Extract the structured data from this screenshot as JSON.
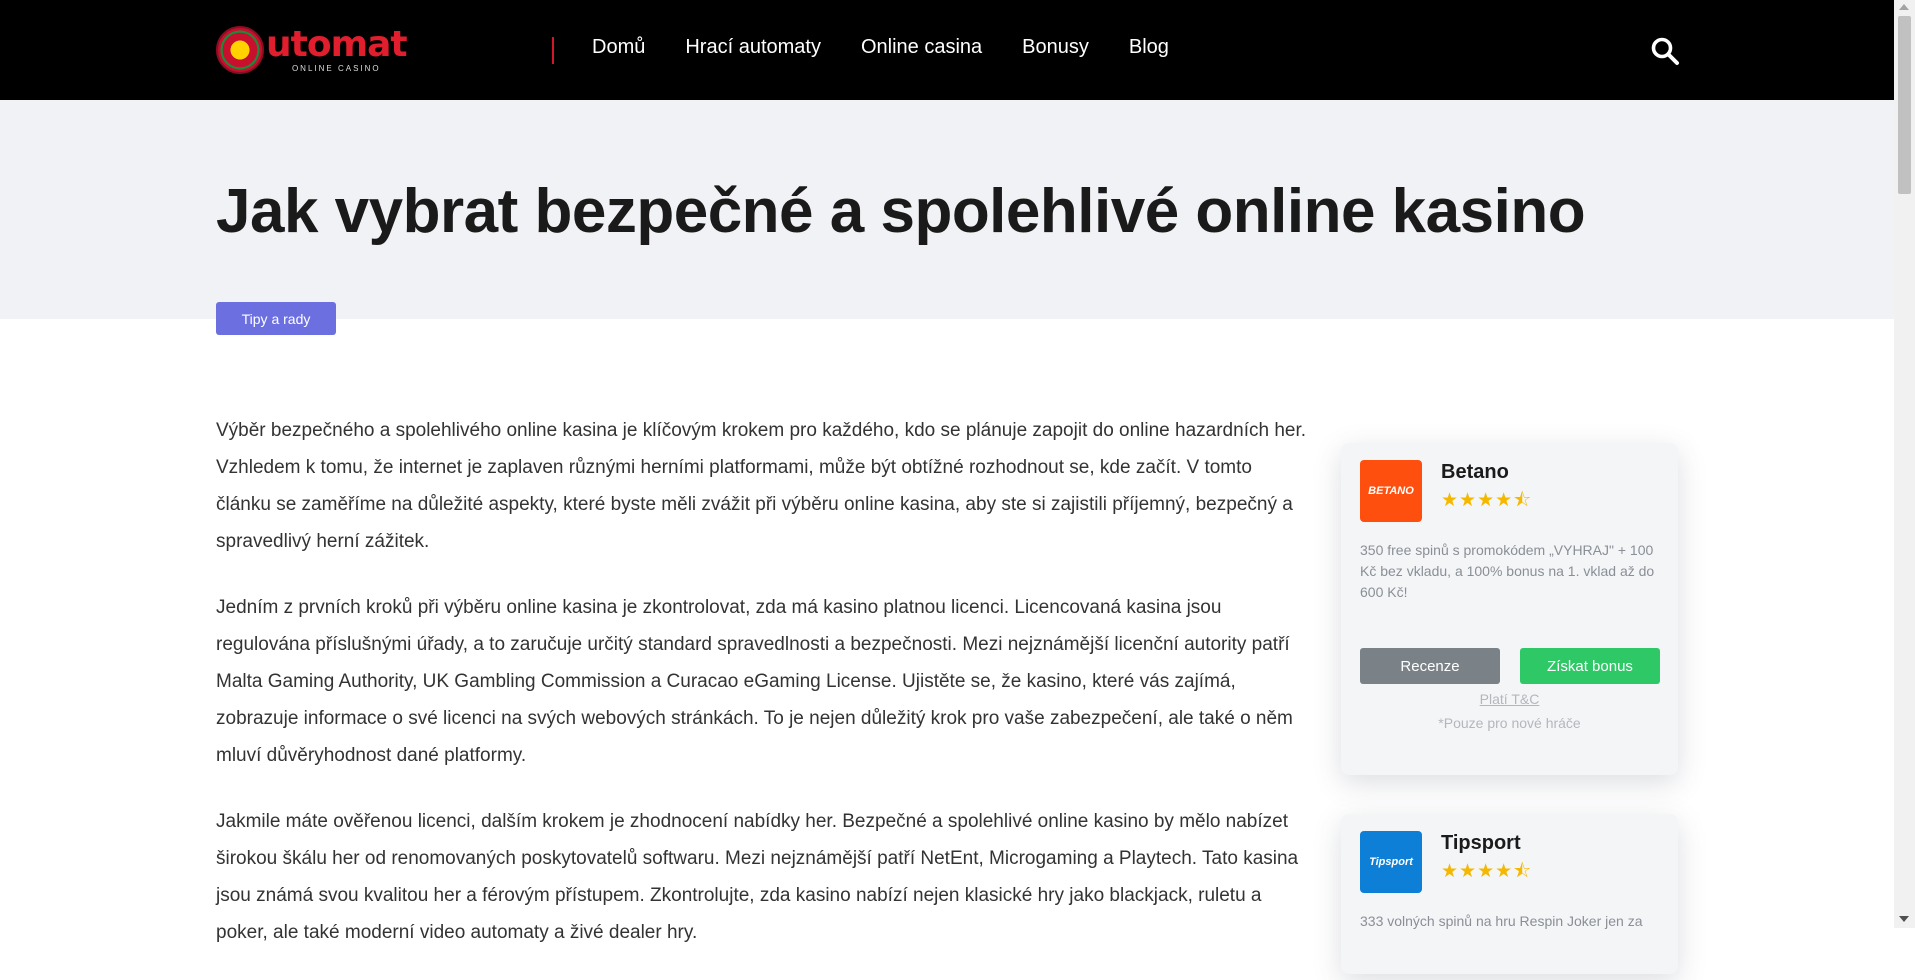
{
  "header": {
    "logo": {
      "text": "utomat",
      "subtitle": "ONLINE CASINO"
    },
    "nav": [
      {
        "label": "Domů"
      },
      {
        "label": "Hrací automaty"
      },
      {
        "label": "Online casina"
      },
      {
        "label": "Bonusy"
      },
      {
        "label": "Blog"
      }
    ],
    "search_icon": "search-icon"
  },
  "page": {
    "title": "Jak vybrat bezpečné a spolehlivé online kasino",
    "tag": "Tipy a rady"
  },
  "article": {
    "paragraphs": [
      "Výběr bezpečného a spolehlivého online kasina je klíčovým krokem pro každého, kdo se plánuje zapojit do online hazardních her. Vzhledem k tomu, že internet je zaplaven různými herními platformami, může být obtížné rozhodnout se, kde začít. V tomto článku se zaměříme na důležité aspekty, které byste měli zvážit při výběru online kasina, aby ste si zajistili příjemný, bezpečný a spravedlivý herní zážitek.",
      "Jedním z prvních kroků při výběru online kasina je zkontrolovat, zda má kasino platnou licenci. Licencovaná kasina jsou regulována příslušnými úřady, a to zaručuje určitý standard spravedlnosti a bezpečnosti. Mezi nejznámější licenční autority patří Malta Gaming Authority, UK Gambling Commission a Curacao eGaming License. Ujistěte se, že kasino, které vás zajímá, zobrazuje informace o své licenci na svých webových stránkách. To je nejen důležitý krok pro vaše zabezpečení, ale také o něm mluví důvěryhodnost dané platformy.",
      "Jakmile máte ověřenou licenci, dalším krokem je zhodnocení nabídky her. Bezpečné a spolehlivé online kasino by mělo nabízet širokou škálu her od renomovaných poskytovatelů softwaru. Mezi nejznámější patří NetEnt, Microgaming a Playtech. Tato kasina jsou známá svou kvalitou her a férovým přístupem. Zkontrolujte, zda kasino nabízí nejen klasické hry jako blackjack, ruletu a poker, ale také moderní video automaty a živé dealer hry."
    ]
  },
  "sidebar": {
    "cards": [
      {
        "name": "Betano",
        "logo_text": "BETANO",
        "rating": 4.5,
        "stars": "★★★★⯪",
        "bonus": "350 free spinů s promokódem „VYHRAJ\" + 100 Kč bez vkladu, a 100% bonus na 1. vklad až do 600 Kč!",
        "review_label": "Recenze",
        "bonus_label": "Získat bonus",
        "tc_label": "Platí T&C",
        "note": "*Pouze pro nové hráče",
        "brand_color": "#ff4f0e"
      },
      {
        "name": "Tipsport",
        "logo_text": "Tipsport",
        "rating": 4.5,
        "stars": "★★★★⯪",
        "bonus": "333 volných spinů na hru Respin Joker jen za",
        "brand_color": "#0d7fd6"
      }
    ]
  },
  "colors": {
    "header_bg": "#000000",
    "accent_red": "#e01e2e",
    "tag_bg": "#6c6fe0",
    "bonus_button": "#2ec866",
    "review_button": "#7a8287",
    "star": "#f5b800"
  }
}
